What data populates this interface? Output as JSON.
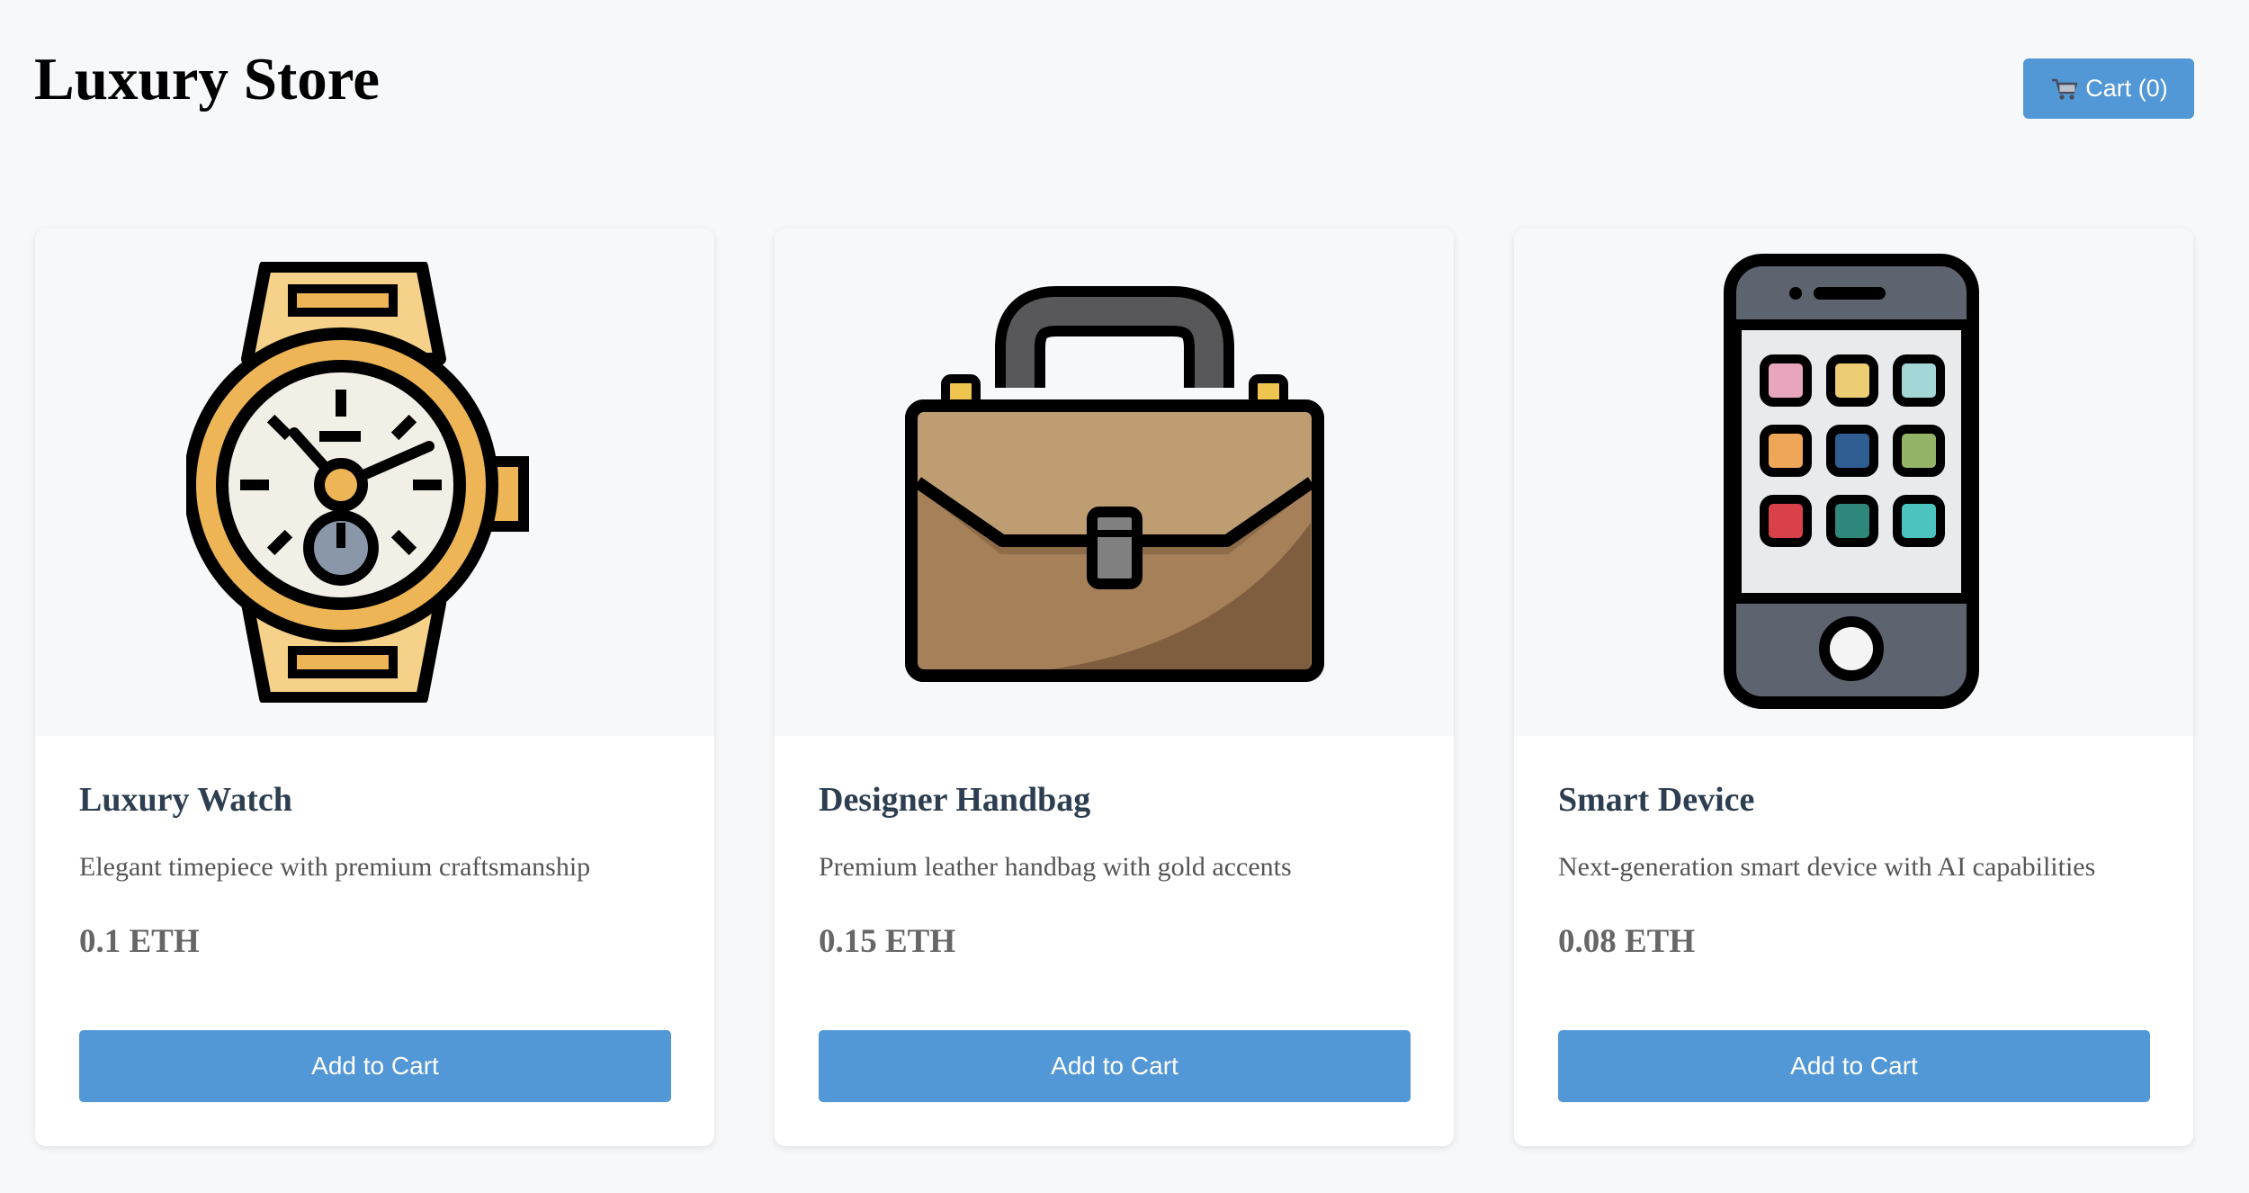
{
  "header": {
    "title": "Luxury Store",
    "cart_label": "Cart (0)",
    "cart_icon": "shopping-cart-icon"
  },
  "products": [
    {
      "name": "Luxury Watch",
      "description": "Elegant timepiece with premium craftsmanship",
      "price": "0.1 ETH",
      "button_label": "Add to Cart",
      "icon": "watch-icon"
    },
    {
      "name": "Designer Handbag",
      "description": "Premium leather handbag with gold accents",
      "price": "0.15 ETH",
      "button_label": "Add to Cart",
      "icon": "briefcase-icon"
    },
    {
      "name": "Smart Device",
      "description": "Next-generation smart device with AI capabilities",
      "price": "0.08 ETH",
      "button_label": "Add to Cart",
      "icon": "smartphone-icon"
    }
  ],
  "colors": {
    "accent": "#5297d6",
    "page_background": "#f7f8fa",
    "card_background": "#ffffff",
    "title_text": "#2c3e50"
  }
}
